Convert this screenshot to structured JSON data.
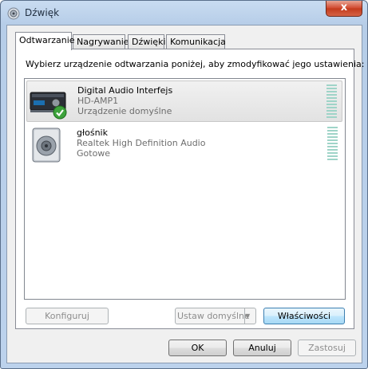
{
  "window": {
    "title": "Dźwięk",
    "close_label": "x"
  },
  "tabs": [
    {
      "label": "Odtwarzanie",
      "active": true
    },
    {
      "label": "Nagrywanie",
      "active": false
    },
    {
      "label": "Dźwięki",
      "active": false
    },
    {
      "label": "Komunikacja",
      "active": false
    }
  ],
  "instruction": "Wybierz urządzenie odtwarzania poniżej, aby zmodyfikować jego ustawienia:",
  "devices": [
    {
      "name": "Digital Audio Interfejs",
      "detail": "HD-AMP1",
      "status": "Urządzenie domyślne",
      "icon": "digital-audio-device-icon",
      "selected": true,
      "is_default": true
    },
    {
      "name": "głośnik",
      "detail": "Realtek High Definition Audio",
      "status": "Gotowe",
      "icon": "speaker-icon",
      "selected": false,
      "is_default": false
    }
  ],
  "buttons": {
    "configure": "Konfiguruj",
    "set_default": "Ustaw domyślne",
    "properties": "Właściwości",
    "ok": "OK",
    "cancel": "Anuluj",
    "apply": "Zastosuj"
  },
  "colors": {
    "accent": "#3c7fb1",
    "level_meter": "#9fd4c8",
    "close": "#c23a1c"
  }
}
